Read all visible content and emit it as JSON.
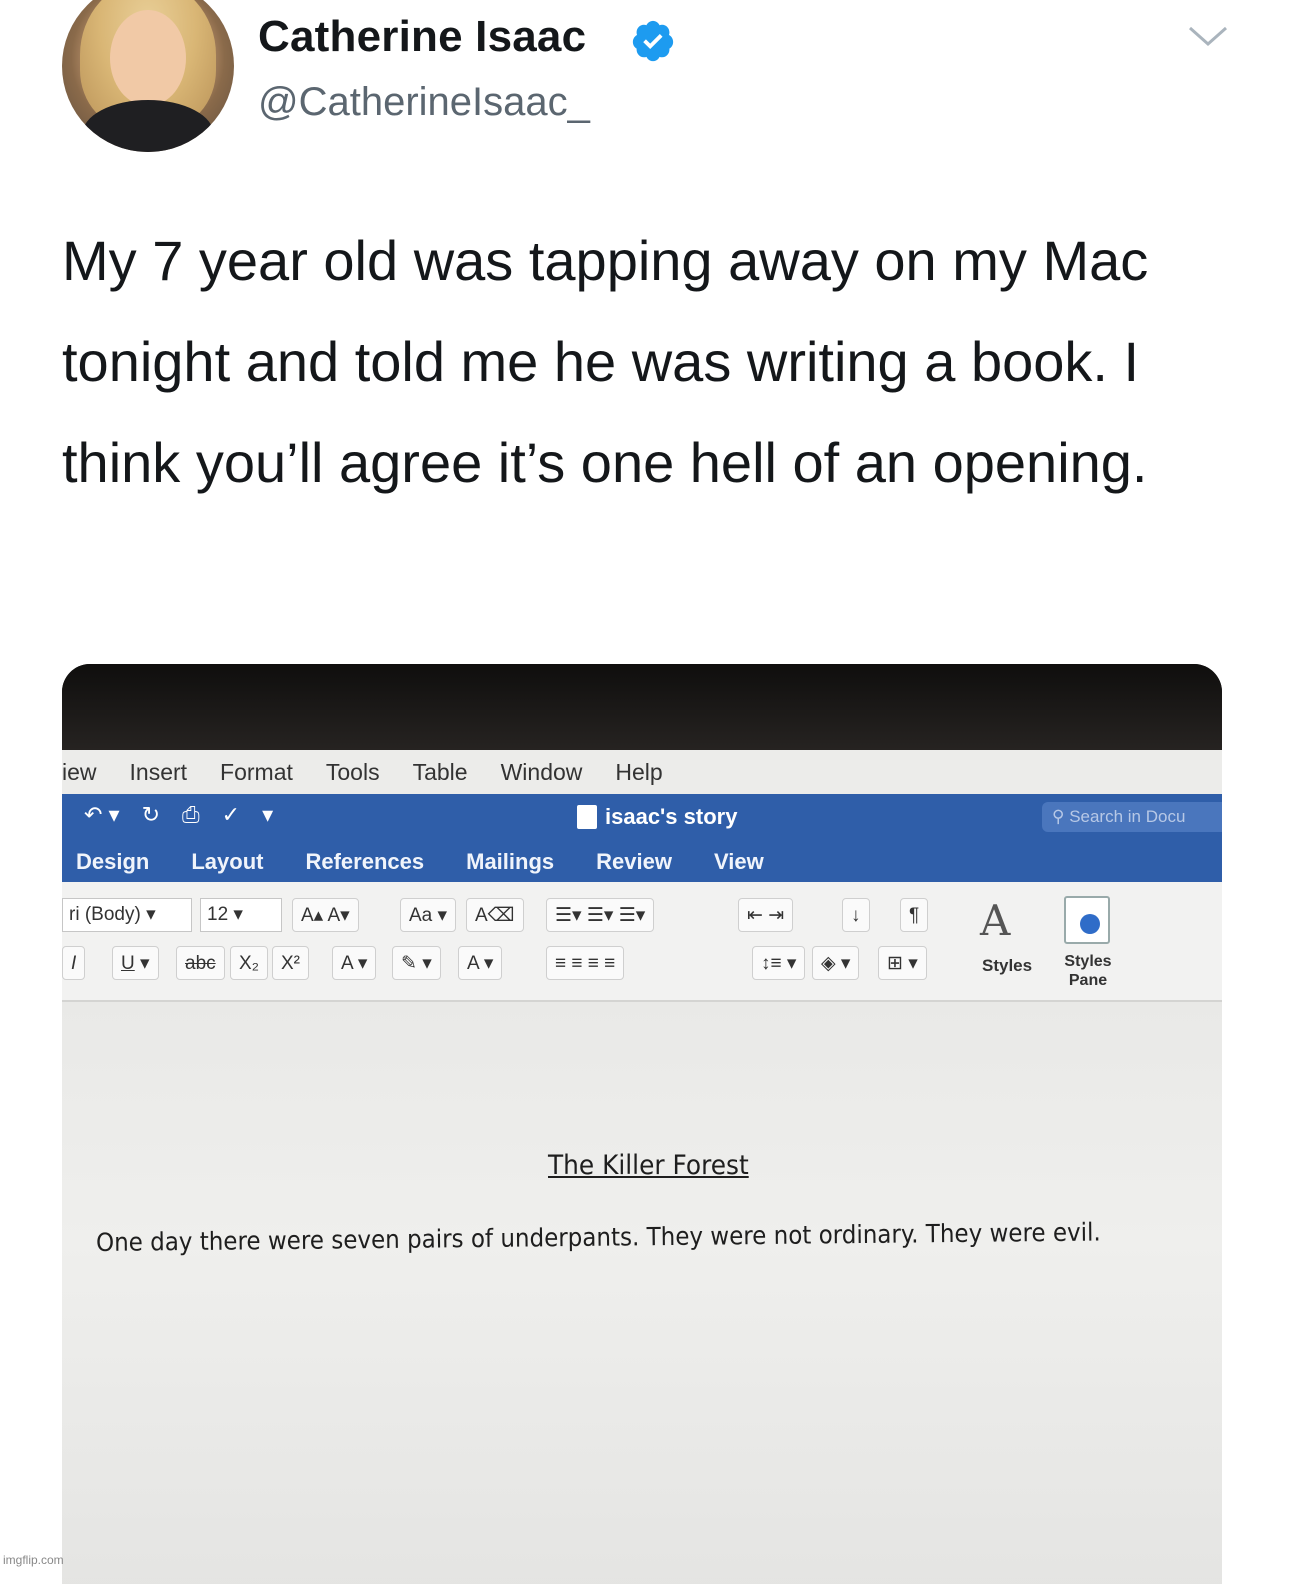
{
  "tweet": {
    "display_name": "Catherine Isaac",
    "handle": "@CatherineIsaac_",
    "text": "My 7 year old was tapping away on my Mac tonight and told me he was writing a book. I think you’ll agree it’s one hell of an opening.",
    "verified_color": "#1d9bf0"
  },
  "word": {
    "menu": [
      "iew",
      "Insert",
      "Format",
      "Tools",
      "Table",
      "Window",
      "Help"
    ],
    "doc_title": "isaac's story",
    "search_placeholder": "Search in Docu",
    "tabs": [
      "Design",
      "Layout",
      "References",
      "Mailings",
      "Review",
      "View"
    ],
    "font_name": "ri (Body)",
    "font_size": "12",
    "styles_label": "Styles",
    "styles_pane_label": "Styles Pane",
    "accent_color": "#2f5ea9"
  },
  "document": {
    "heading": "The Killer Forest",
    "body": "One day there were seven pairs of underpants. They were not ordinary. They were evil."
  },
  "watermark": "imgflip.com"
}
